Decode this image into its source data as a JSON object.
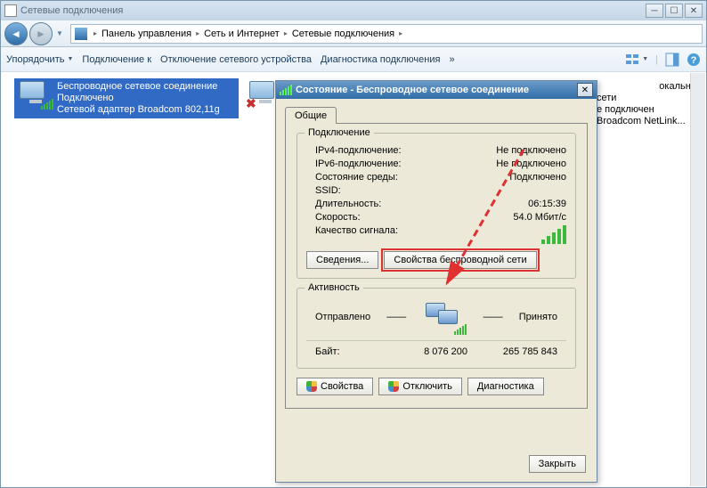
{
  "window": {
    "title": "Сетевые подключения"
  },
  "breadcrumb": {
    "items": [
      "Панель управления",
      "Сеть и Интернет",
      "Сетевые подключения"
    ]
  },
  "toolbar": {
    "organize": "Упорядочить",
    "connect_to": "Подключение к",
    "disable": "Отключение сетевого устройства",
    "diagnose": "Диагностика подключения",
    "more": "»"
  },
  "connections": {
    "wireless": {
      "name": "Беспроводное сетевое соединение",
      "status": "Подключено",
      "adapter": "Сетевой адаптер Broadcom 802,11g"
    },
    "lan": {
      "name_suffix": "                       окальной сети",
      "status_suffix": "е подключен",
      "adapter_suffix": "Broadcom NetLink..."
    }
  },
  "dialog": {
    "title": "Состояние - Беспроводное сетевое соединение",
    "tab": "Общие",
    "groups": {
      "connection": "Подключение",
      "activity": "Активность"
    },
    "fields": {
      "ipv4_label": "IPv4-подключение:",
      "ipv4_value": "Не подключено",
      "ipv6_label": "IPv6-подключение:",
      "ipv6_value": "Не подключено",
      "media_label": "Состояние среды:",
      "media_value": "Подключено",
      "ssid_label": "SSID:",
      "ssid_value": "",
      "duration_label": "Длительность:",
      "duration_value": "06:15:39",
      "speed_label": "Скорость:",
      "speed_value": "54.0 Мбит/с",
      "signal_label": "Качество сигнала:"
    },
    "buttons": {
      "details": "Сведения...",
      "wifi_props": "Свойства беспроводной сети",
      "properties": "Свойства",
      "disable": "Отключить",
      "diagnose": "Диагностика",
      "close": "Закрыть"
    },
    "activity": {
      "sent_label": "Отправлено",
      "recv_label": "Принято",
      "bytes_label": "Байт:",
      "bytes_sent": "8 076 200",
      "bytes_recv": "265 785 843",
      "dashes": "——"
    }
  }
}
